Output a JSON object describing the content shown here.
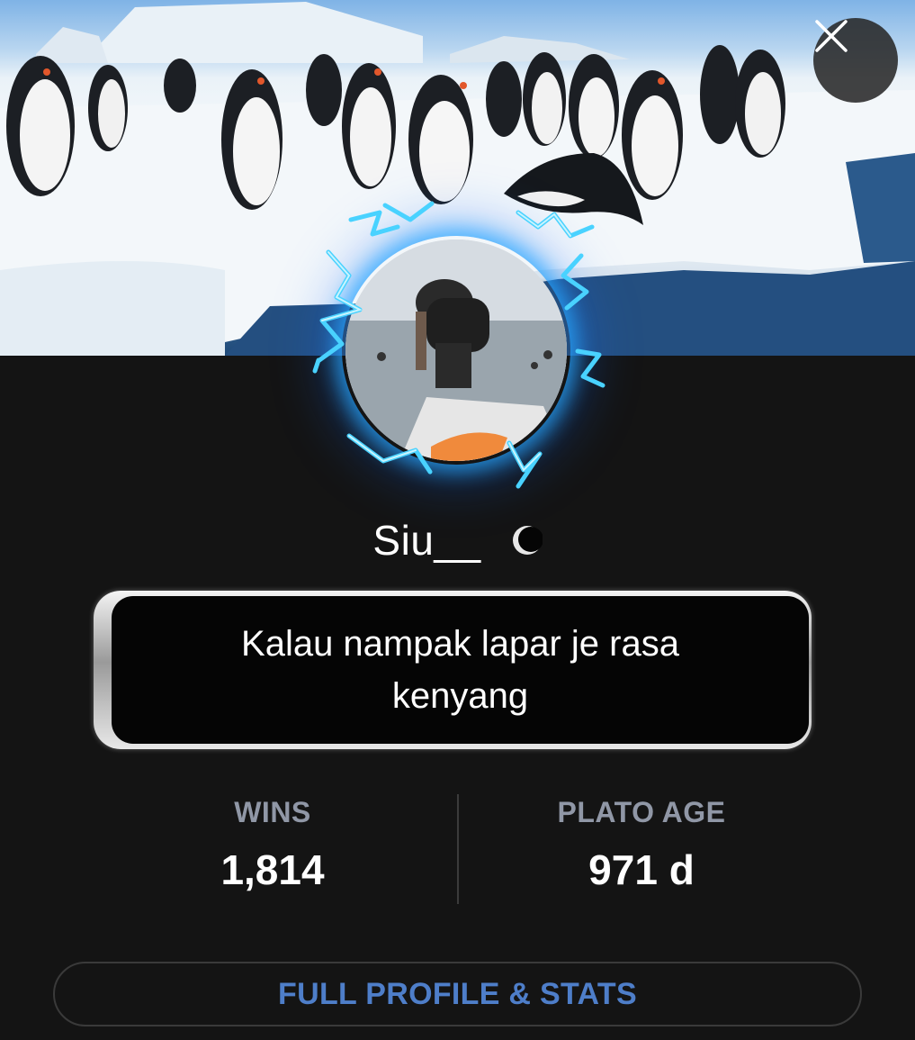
{
  "profile": {
    "username": "Siu__",
    "bio": "Kalau nampak lapar je rasa kenyang"
  },
  "stats": [
    {
      "label": "WINS",
      "value": "1,814"
    },
    {
      "label": "PLATO AGE",
      "value": "971 d"
    }
  ],
  "actions": {
    "full_profile_label": "FULL PROFILE & STATS",
    "close_icon": "close-icon"
  },
  "colors": {
    "background": "#141414",
    "stat_label": "#9097a6",
    "button_text": "#4e7ec9",
    "avatar_glow": "#28aaff"
  }
}
